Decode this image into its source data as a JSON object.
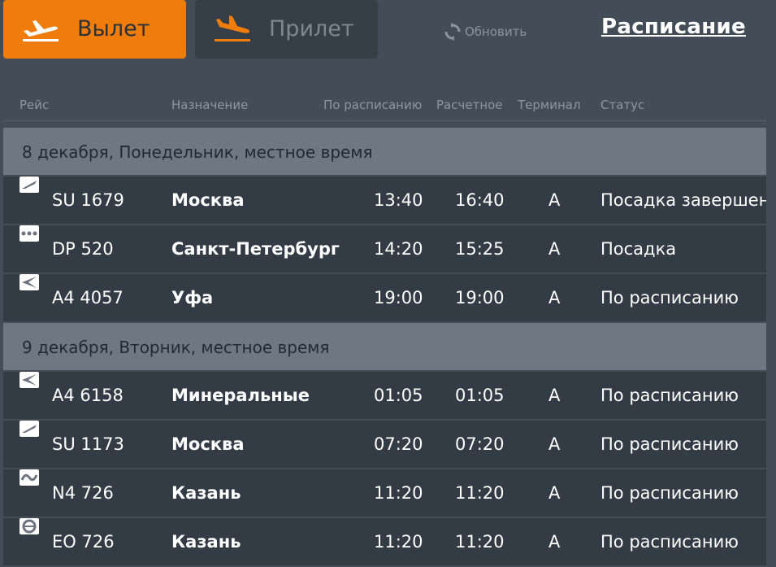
{
  "tabs": {
    "departure_label": "Вылет",
    "arrival_label": "Прилет"
  },
  "refresh_label": "Обновить",
  "schedule_link": "Расписание",
  "columns": {
    "flight": "Рейс",
    "destination": "Назначение",
    "scheduled": "По расписанию",
    "estimated": "Расчетное",
    "terminal": "Терминал",
    "status": "Статус"
  },
  "days": [
    {
      "title": "8 декабря, Понедельник, местное время",
      "flights": [
        {
          "logo": "aeroflot-logo",
          "flight": "SU 1679",
          "destination": "Москва",
          "scheduled": "13:40",
          "estimated": "16:40",
          "terminal": "A",
          "status": "Посадка завершена"
        },
        {
          "logo": "pobeda-logo",
          "flight": "DP 520",
          "destination": "Санкт-Петербург",
          "scheduled": "14:20",
          "estimated": "15:25",
          "terminal": "A",
          "status": "Посадка"
        },
        {
          "logo": "nordavia-logo",
          "flight": "A4 4057",
          "destination": "Уфа",
          "scheduled": "19:00",
          "estimated": "19:00",
          "terminal": "A",
          "status": "По расписанию"
        }
      ]
    },
    {
      "title": "9 декабря, Вторник, местное время",
      "flights": [
        {
          "logo": "nordavia-logo",
          "flight": "A4 6158",
          "destination": "Минеральные",
          "scheduled": "01:05",
          "estimated": "01:05",
          "terminal": "A",
          "status": "По расписанию"
        },
        {
          "logo": "aeroflot-logo",
          "flight": "SU 1173",
          "destination": "Москва",
          "scheduled": "07:20",
          "estimated": "07:20",
          "terminal": "A",
          "status": "По расписанию"
        },
        {
          "logo": "nordwind-logo",
          "flight": "N4 726",
          "destination": "Казань",
          "scheduled": "11:20",
          "estimated": "11:20",
          "terminal": "A",
          "status": "По расписанию"
        },
        {
          "logo": "ikar-logo",
          "flight": "EO 726",
          "destination": "Казань",
          "scheduled": "11:20",
          "estimated": "11:20",
          "terminal": "A",
          "status": "По расписанию"
        }
      ]
    }
  ],
  "colors": {
    "background": "#434d58",
    "accent": "#ef7c0b",
    "row": "#333b45",
    "day_header": "#6d7882"
  }
}
